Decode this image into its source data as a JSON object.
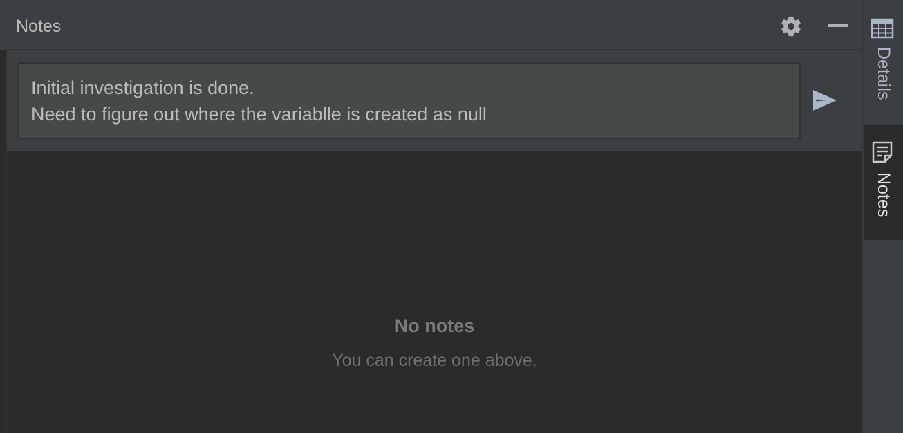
{
  "panel": {
    "title": "Notes"
  },
  "header": {
    "settings_icon": "gear-icon",
    "minimize_icon": "minimize-icon"
  },
  "compose": {
    "value": "Initial investigation is done.\nNeed to figure out where the variablle is created as null",
    "send_icon": "send-icon"
  },
  "empty_state": {
    "title": "No notes",
    "subtitle": "You can create one above."
  },
  "side_tabs": [
    {
      "label": "Details",
      "icon": "table-icon",
      "active": false
    },
    {
      "label": "Notes",
      "icon": "notes-icon",
      "active": true
    }
  ],
  "colors": {
    "panel_bg": "#2b2b2b",
    "header_bg": "#3c3f41",
    "input_bg": "#45494a",
    "text": "#bbbbbb",
    "icon": "#a9b7c6"
  }
}
